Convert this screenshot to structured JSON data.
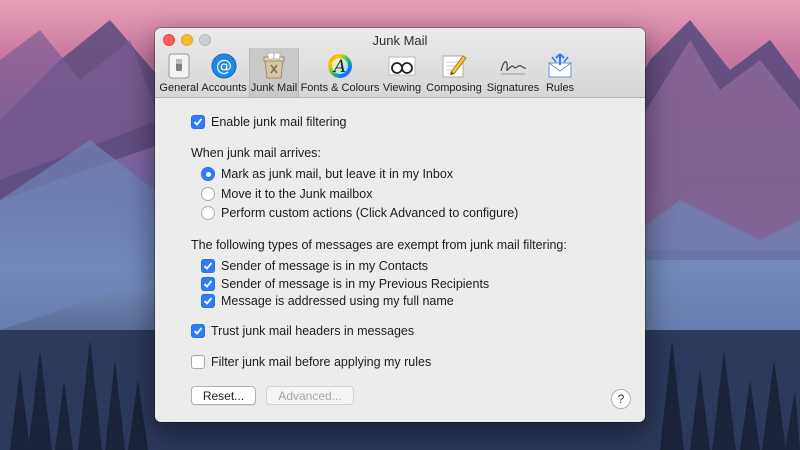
{
  "window": {
    "title": "Junk Mail"
  },
  "toolbar": {
    "tabs": [
      {
        "label": "General",
        "icon": "switch-icon"
      },
      {
        "label": "Accounts",
        "icon": "at-sign-icon"
      },
      {
        "label": "Junk Mail",
        "icon": "junk-bin-icon",
        "active": true
      },
      {
        "label": "Fonts & Colours",
        "icon": "font-colour-icon"
      },
      {
        "label": "Viewing",
        "icon": "glasses-icon"
      },
      {
        "label": "Composing",
        "icon": "pencil-paper-icon"
      },
      {
        "label": "Signatures",
        "icon": "signature-icon"
      },
      {
        "label": "Rules",
        "icon": "rules-envelope-icon"
      }
    ]
  },
  "settings": {
    "enable_filtering": {
      "label": "Enable junk mail filtering",
      "checked": true
    },
    "arrival_heading": "When junk mail arrives:",
    "arrival_options": [
      {
        "label": "Mark as junk mail, but leave it in my Inbox",
        "selected": true
      },
      {
        "label": "Move it to the Junk mailbox",
        "selected": false
      },
      {
        "label": "Perform custom actions (Click Advanced to configure)",
        "selected": false
      }
    ],
    "exempt_heading": "The following types of messages are exempt from junk mail filtering:",
    "exempt_options": [
      {
        "label": "Sender of message is in my Contacts",
        "checked": true
      },
      {
        "label": "Sender of message is in my Previous Recipients",
        "checked": true
      },
      {
        "label": "Message is addressed using my full name",
        "checked": true
      }
    ],
    "trust_headers": {
      "label": "Trust junk mail headers in messages",
      "checked": true
    },
    "filter_before_rules": {
      "label": "Filter junk mail before applying my rules",
      "checked": false
    }
  },
  "buttons": {
    "reset": "Reset...",
    "advanced": "Advanced...",
    "help": "?"
  },
  "colors": {
    "accent": "#2f7cf6"
  }
}
